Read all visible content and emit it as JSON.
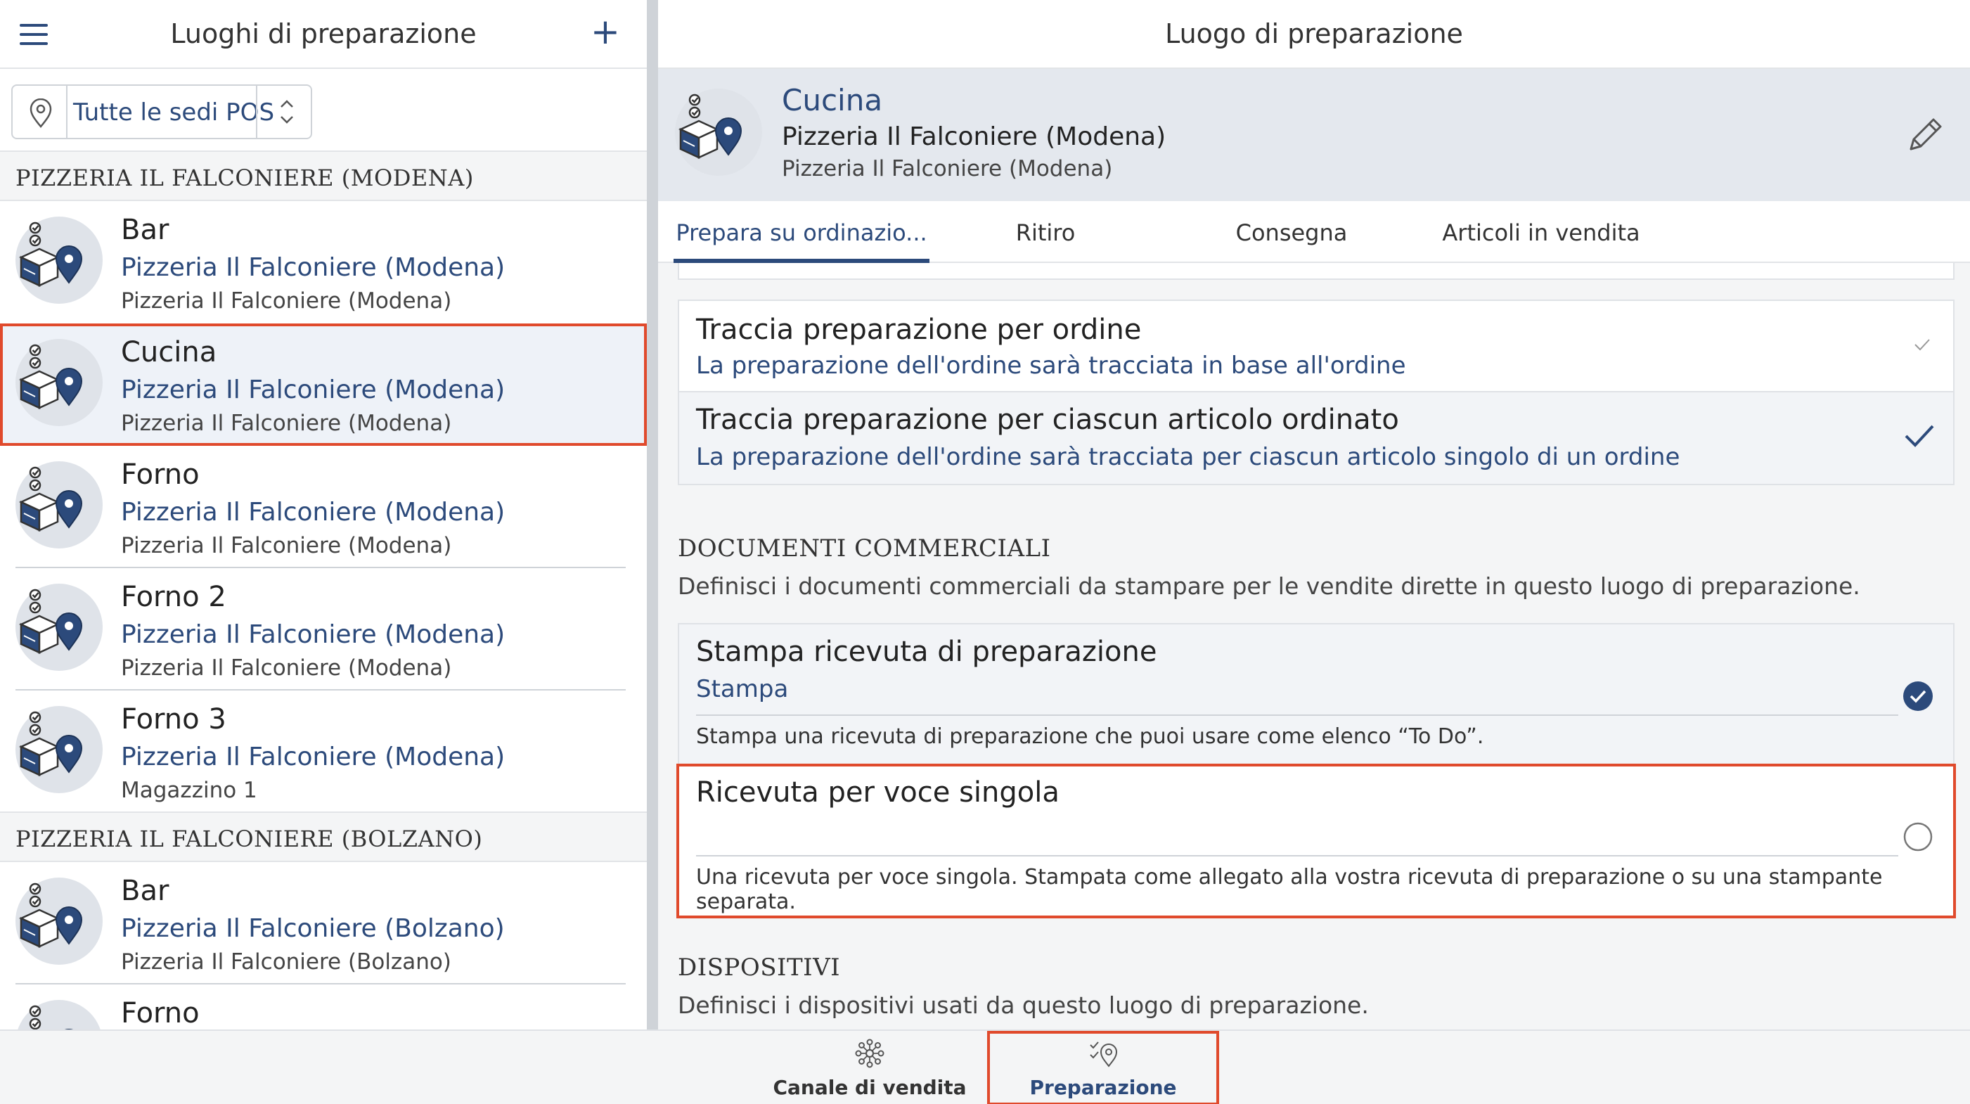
{
  "left_panel": {
    "title": "Luoghi di preparazione",
    "add_label": "+",
    "pos_selector": {
      "value": "Tutte le sedi POS"
    },
    "sections": [
      {
        "header": "PIZZERIA IL FALCONIERE (MODENA)",
        "items": [
          {
            "name": "Bar",
            "site": "Pizzeria Il Falconiere (Modena)",
            "warehouse": "Pizzeria Il Falconiere (Modena)"
          },
          {
            "name": "Cucina",
            "site": "Pizzeria Il Falconiere (Modena)",
            "warehouse": "Pizzeria Il Falconiere (Modena)",
            "selected": true
          },
          {
            "name": "Forno",
            "site": "Pizzeria Il Falconiere (Modena)",
            "warehouse": "Pizzeria Il Falconiere (Modena)"
          },
          {
            "name": "Forno 2",
            "site": "Pizzeria Il Falconiere (Modena)",
            "warehouse": "Pizzeria Il Falconiere (Modena)"
          },
          {
            "name": "Forno 3",
            "site": "Pizzeria Il Falconiere (Modena)",
            "warehouse": "Magazzino 1"
          }
        ]
      },
      {
        "header": "PIZZERIA IL FALCONIERE (BOLZANO)",
        "items": [
          {
            "name": "Bar",
            "site": "Pizzeria Il Falconiere (Bolzano)",
            "warehouse": "Pizzeria Il Falconiere (Bolzano)"
          },
          {
            "name": "Forno",
            "site": "",
            "warehouse": ""
          }
        ]
      }
    ]
  },
  "right_panel": {
    "title": "Luogo di preparazione",
    "detail": {
      "name": "Cucina",
      "site": "Pizzeria Il Falconiere (Modena)",
      "warehouse": "Pizzeria Il Falconiere (Modena)"
    },
    "tabs": [
      {
        "label": "Prepara su ordinazio...",
        "active": true
      },
      {
        "label": "Ritiro"
      },
      {
        "label": "Consegna"
      },
      {
        "label": "Articoli in vendita"
      }
    ],
    "tracking_options": [
      {
        "title": "Traccia preparazione per ordine",
        "subtitle": "La preparazione dell'ordine sarà tracciata in base all'ordine",
        "selected": false
      },
      {
        "title": "Traccia preparazione per ciascun articolo ordinato",
        "subtitle": "La preparazione dell'ordine sarà tracciata per ciascun articolo singolo di un ordine",
        "selected": true
      }
    ],
    "documenti": {
      "header": "DOCUMENTI COMMERCIALI",
      "description": "Definisci i documenti commerciali da stampare per le vendite dirette in questo luogo di preparazione.",
      "items": [
        {
          "title": "Stampa ricevuta di preparazione",
          "subtitle": "Stampa",
          "footnote": "Stampa una ricevuta di preparazione che puoi usare come elenco “To Do”.",
          "checked": true
        },
        {
          "title": "Ricevuta per voce singola",
          "subtitle": "",
          "footnote": "Una ricevuta per voce singola. Stampata come allegato alla vostra ricevuta di preparazione o su una stampante separata.",
          "checked": false
        }
      ]
    },
    "dispositivi": {
      "header": "DISPOSITIVI",
      "description": "Definisci i dispositivi usati da questo luogo di preparazione."
    }
  },
  "bottom_nav": [
    {
      "label": "Canale di vendita",
      "icon": "sales-channel-icon",
      "active": false
    },
    {
      "label": "Preparazione",
      "icon": "preparation-icon",
      "active": true
    }
  ],
  "colors": {
    "accent": "#2c4a7b",
    "highlight": "#e04a2c",
    "panel_bg": "#f4f5f6",
    "detail_bg": "#e4e8ee"
  }
}
